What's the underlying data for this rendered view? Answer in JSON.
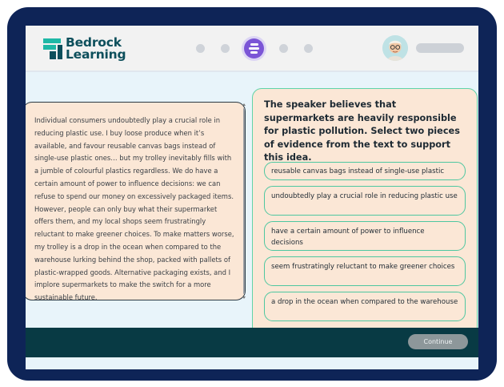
{
  "brand": {
    "line1": "Bedrock",
    "line2": "Learning"
  },
  "progress": {
    "total_steps": 5,
    "current_step": 3
  },
  "passage": {
    "text": "Individual consumers undoubtedly play a crucial role in reducing plastic use. I buy loose produce when it’s available, and favour reusable canvas bags instead of single-use plastic ones… but my trolley inevitably fills with a jumble of colourful plastics regardless. We do have a certain amount of power to influence decisions: we can refuse to spend our money on excessively packaged items. However, people can only buy what their supermarket offers them, and my local shops seem frustratingly reluctant to make greener choices. To make matters worse, my trolley is a drop in the ocean when compared to the warehouse lurking behind the shop, packed with pallets of plastic-wrapped goods. Alternative packaging exists, and I implore supermarkets to make the switch for a more sustainable future."
  },
  "question": {
    "prompt": "The speaker believes that supermarkets are heavily responsible for plastic pollution. Select two pieces of evidence from the text to support this idea.",
    "options": [
      {
        "label": "reusable canvas bags instead of single-use plastic"
      },
      {
        "label": "undoubtedly play a crucial role in reducing plastic use"
      },
      {
        "label": "have a certain amount of power to influence decisions"
      },
      {
        "label": "seem frustratingly reluctant to make greener choices"
      },
      {
        "label": "a drop in the ocean when compared to the warehouse"
      }
    ]
  },
  "footer": {
    "continue_label": "Continue"
  },
  "colors": {
    "frame": "#0e2457",
    "panel": "#fbe7d6",
    "accent_green": "#4ec7a0",
    "footer": "#083a44",
    "active_step": "#7b55d6"
  },
  "icons": {
    "logo": "bedrock-logo-mark",
    "active_step": "lines-icon",
    "avatar": "user-avatar"
  }
}
